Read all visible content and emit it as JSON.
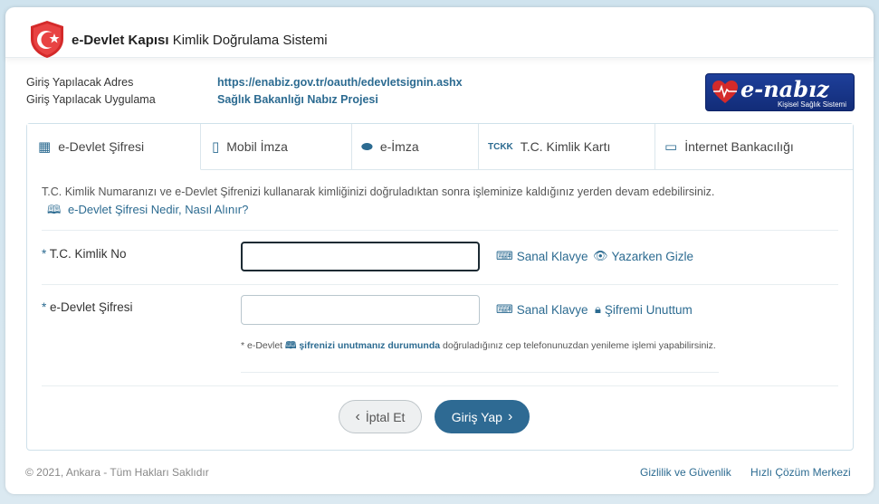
{
  "header": {
    "brand": "e-Devlet Kapısı",
    "subtitle": "Kimlik Doğrulama Sistemi"
  },
  "info": {
    "address_label": "Giriş Yapılacak Adres",
    "address_value": "https://enabiz.gov.tr/oauth/edevletsignin.ashx",
    "app_label": "Giriş Yapılacak Uygulama",
    "app_value": "Sağlık Bakanlığı Nabız Projesi"
  },
  "enabiz_logo": {
    "text": "e-nabız",
    "tagline": "Kişisel Sağlık Sistemi"
  },
  "tabs": [
    {
      "label": "e-Devlet Şifresi",
      "icon": "keypad-icon"
    },
    {
      "label": "Mobil İmza",
      "icon": "mobile-signature-icon"
    },
    {
      "label": "e-İmza",
      "icon": "usb-token-icon"
    },
    {
      "label": "T.C. Kimlik Kartı",
      "icon": "id-card-icon"
    },
    {
      "label": "İnternet Bankacılığı",
      "icon": "credit-card-icon"
    }
  ],
  "form": {
    "description": "T.C. Kimlik Numaranızı ve e-Devlet Şifrenizi kullanarak kimliğinizi doğruladıktan sonra işleminize kaldığınız yerden devam edebilirsiniz.",
    "help_link": "e-Devlet Şifresi Nedir, Nasıl Alınır?",
    "tc_label": "T.C. Kimlik No",
    "tc_value": "",
    "password_label": "e-Devlet Şifresi",
    "password_value": "",
    "required_mark": "*",
    "virtual_keyboard": "Sanal Klavye",
    "hide_typing": "Yazarken Gizle",
    "forgot_password": "Şifremi Unuttum",
    "note_prefix": "* e-Devlet",
    "note_link": "şifrenizi unutmanız durumunda",
    "note_suffix": "doğruladığınız cep telefonunuzdan yenileme işlemi yapabilirsiniz.",
    "cancel_button": "İptal Et",
    "login_button": "Giriş Yap"
  },
  "footer": {
    "copyright": "© 2021, Ankara - Tüm Hakları Saklıdır",
    "privacy": "Gizlilik ve Güvenlik",
    "quick_help": "Hızlı Çözüm Merkezi"
  },
  "colors": {
    "accent": "#2c6b91",
    "logo_red": "#d42a2a",
    "enabiz_blue": "#1e3f9a"
  }
}
